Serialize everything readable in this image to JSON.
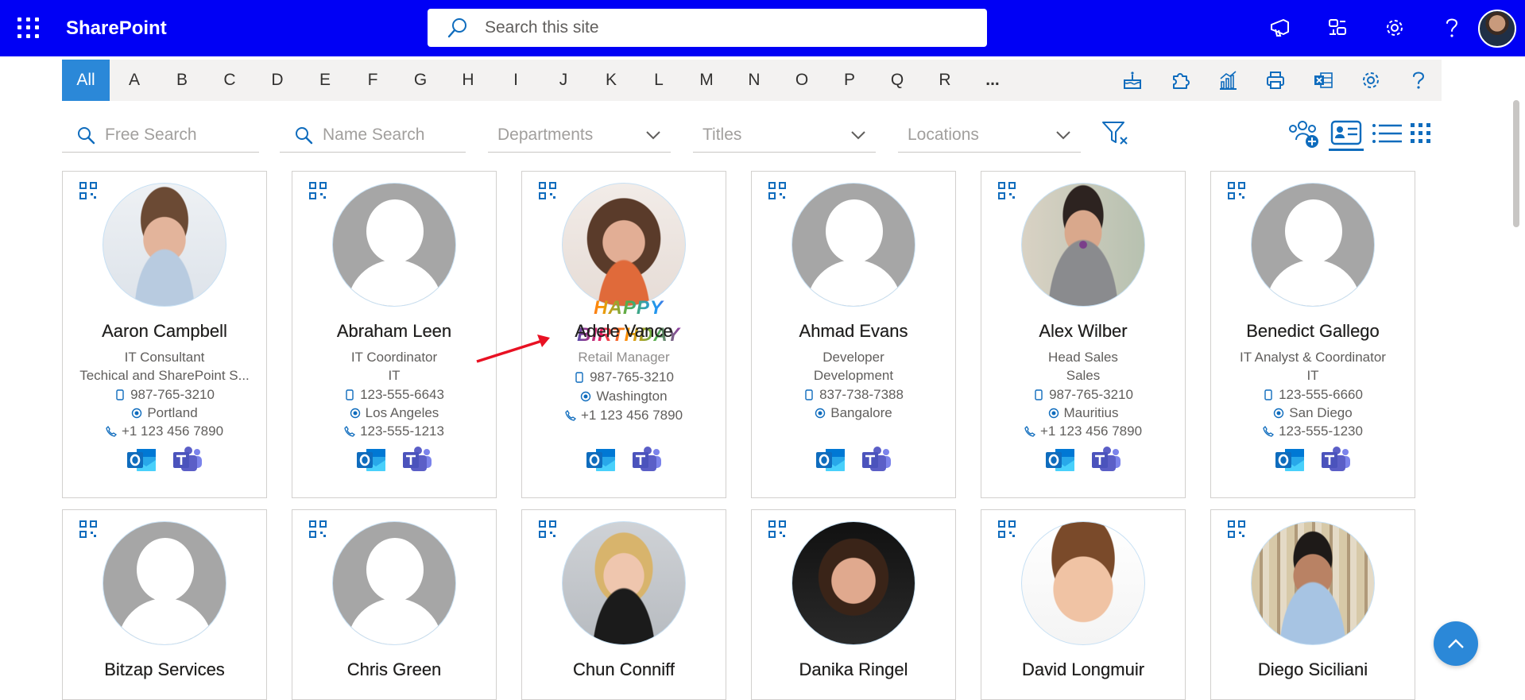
{
  "suitebar": {
    "brand": "SharePoint",
    "search_placeholder": "Search this site",
    "icons": [
      "megaphone-icon",
      "share-icon",
      "settings-icon",
      "help-icon"
    ]
  },
  "letters": [
    "All",
    "A",
    "B",
    "C",
    "D",
    "E",
    "F",
    "G",
    "H",
    "I",
    "J",
    "K",
    "L",
    "M",
    "N",
    "O",
    "P",
    "Q",
    "R",
    "..."
  ],
  "toolbar_icons": [
    "birthday-cake-icon",
    "puzzle-icon",
    "analytics-icon",
    "print-icon",
    "excel-icon",
    "settings-icon",
    "help-icon"
  ],
  "filters": {
    "free_search": "Free Search",
    "name_search": "Name Search",
    "departments": "Departments",
    "titles": "Titles",
    "locations": "Locations"
  },
  "birthday_banner": {
    "line1": "HAPPY",
    "line2": "BIRTHDAY"
  },
  "people": [
    {
      "name": "Aaron Campbell",
      "title": "IT Consultant",
      "department": "Techical and SharePoint S...",
      "mobile": "987-765-3210",
      "location": "Portland",
      "phone": "+1 123 456 7890",
      "photo": "man-blue-shirt"
    },
    {
      "name": "Abraham Leen",
      "title": "IT Coordinator",
      "department": "IT",
      "mobile": "123-555-6643",
      "location": "Los Angeles",
      "phone": "123-555-1213",
      "photo": "default"
    },
    {
      "name": "Adele Vance",
      "title": "Retail Manager",
      "department": "",
      "mobile": "987-765-3210",
      "location": "Washington",
      "phone": "+1 123 456 7890",
      "photo": "woman-birthday"
    },
    {
      "name": "Ahmad Evans",
      "title": "Developer",
      "department": "Development",
      "mobile": "837-738-7388",
      "location": "Bangalore",
      "phone": "",
      "photo": "default"
    },
    {
      "name": "Alex Wilber",
      "title": "Head Sales",
      "department": "Sales",
      "mobile": "987-765-3210",
      "location": "Mauritius",
      "phone": "+1 123 456 7890",
      "photo": "man-tie"
    },
    {
      "name": "Benedict Gallego",
      "title": "IT Analyst & Coordinator",
      "department": "IT",
      "mobile": "123-555-6660",
      "location": "San Diego",
      "phone": "123-555-1230",
      "photo": "default"
    }
  ],
  "people_row2": [
    {
      "name": "Bitzap Services",
      "photo": "default"
    },
    {
      "name": "Chris Green",
      "photo": "default"
    },
    {
      "name": "Chun Conniff",
      "photo": "woman-blonde"
    },
    {
      "name": "Danika Ringel",
      "photo": "woman-glasses"
    },
    {
      "name": "David Longmuir",
      "photo": "man-smile"
    },
    {
      "name": "Diego Siciliani",
      "photo": "man-bookshelf"
    }
  ],
  "colors": {
    "suitebar": "#0000f5",
    "accent": "#2b88d8",
    "outlook": "#0f6cbd",
    "teams": "#5b5fc7"
  }
}
